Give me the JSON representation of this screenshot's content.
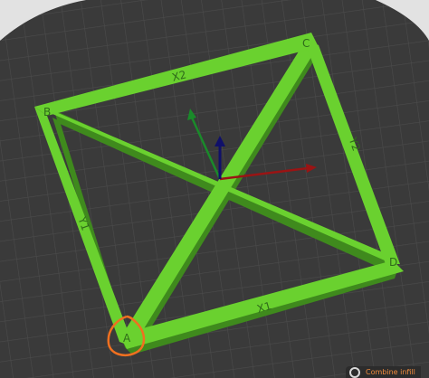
{
  "viewport": {
    "bed_color": "#3a3a3a",
    "grid_color": "#4a4a4a",
    "outside_color": "#e2e2e2",
    "part_color": "#6ad12f",
    "part_side_color": "#3f8a1d",
    "highlight_color": "#f07020"
  },
  "corners": {
    "a": "A",
    "b": "B",
    "c": "C",
    "d": "D"
  },
  "edges": {
    "x1": "X1",
    "x2": "X2",
    "y1": "Y1",
    "y2": "Y2"
  },
  "axes": {
    "x_color": "#9a1414",
    "y_color": "#1a8a2a",
    "z_color": "#10106a"
  },
  "status": {
    "combine_infill_label": "Combine infill"
  }
}
